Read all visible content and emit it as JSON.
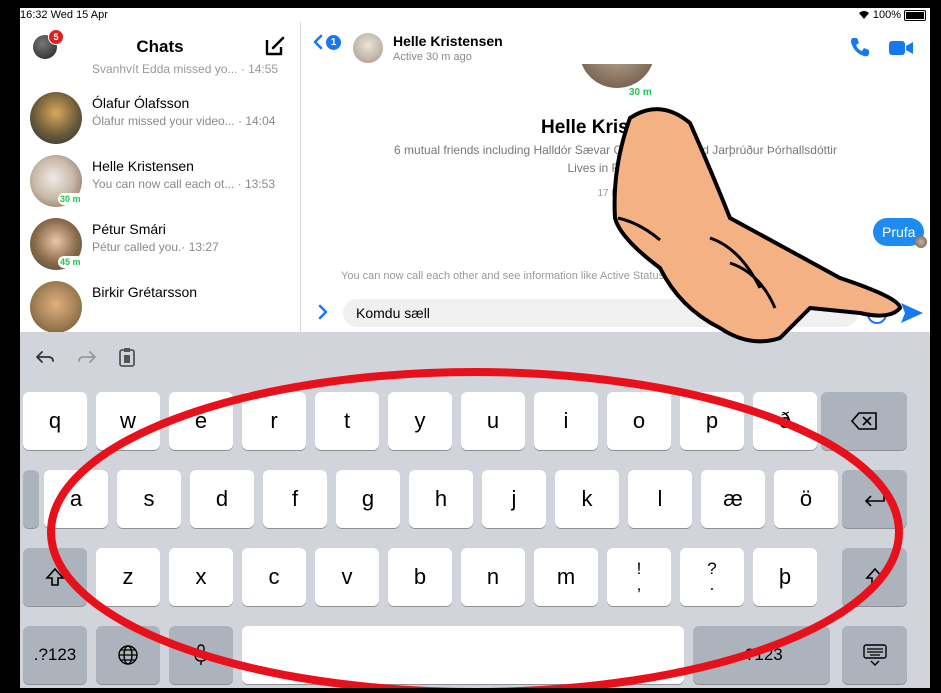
{
  "status_bar": {
    "time": "16:32",
    "date": "Wed 15 Apr",
    "battery": "100%"
  },
  "sidebar": {
    "title": "Chats",
    "badge_count": "5",
    "partial_row_text": "Svanhvít Edda missed yo... · 14:55",
    "chats": [
      {
        "name": "Ólafur Ólafsson",
        "preview": "Ólafur missed your video... · 14:04",
        "active": ""
      },
      {
        "name": "Helle Kristensen",
        "preview": "You can now call each ot... · 13:53",
        "active": "30 m"
      },
      {
        "name": "Pétur Smári",
        "preview": "Pétur called you.· 13:27",
        "active": "45 m"
      },
      {
        "name": "Birkir Grétarsson",
        "preview": "",
        "active": ""
      }
    ]
  },
  "conversation": {
    "back_count": "1",
    "header_name": "Helle Kristensen",
    "header_status": "Active 30 m ago",
    "profile_active": "30 m",
    "profile_name": "Helle Kristensen",
    "mutual_friends": "6 mutual friends including Halldór Sævar Guðbergsson and Jarþrúður Þórhallsdóttir",
    "lives_in": "Lives in Reykjavík",
    "date_separator": "17 MAR",
    "message_bubble": "Prufa",
    "info_line": "You can now call each other and see information like Active Status and when you've read messages.",
    "input_value": "Komdu sæll"
  },
  "keyboard": {
    "row1": [
      "q",
      "w",
      "e",
      "r",
      "t",
      "y",
      "u",
      "i",
      "o",
      "p",
      "ð"
    ],
    "row2": [
      "a",
      "s",
      "d",
      "f",
      "g",
      "h",
      "j",
      "k",
      "l",
      "æ",
      "ö"
    ],
    "row3": [
      "z",
      "x",
      "c",
      "v",
      "b",
      "n",
      "m",
      "!\n,",
      "?\n.",
      "þ"
    ],
    "numbers_label": ".?123",
    "numbers_label_right": ".?123"
  },
  "icons": [
    "compose-icon",
    "phone-icon",
    "video-camera-icon",
    "send-icon",
    "undo-icon",
    "redo-icon",
    "paste-icon",
    "backspace-icon",
    "return-icon",
    "shift-icon",
    "globe-icon",
    "microphone-icon",
    "keyboard-dismiss-icon"
  ],
  "colors": {
    "accent": "#1877f2",
    "active_green": "#23c451",
    "annotation_red": "#e8101a",
    "badge_red": "#e02020"
  }
}
